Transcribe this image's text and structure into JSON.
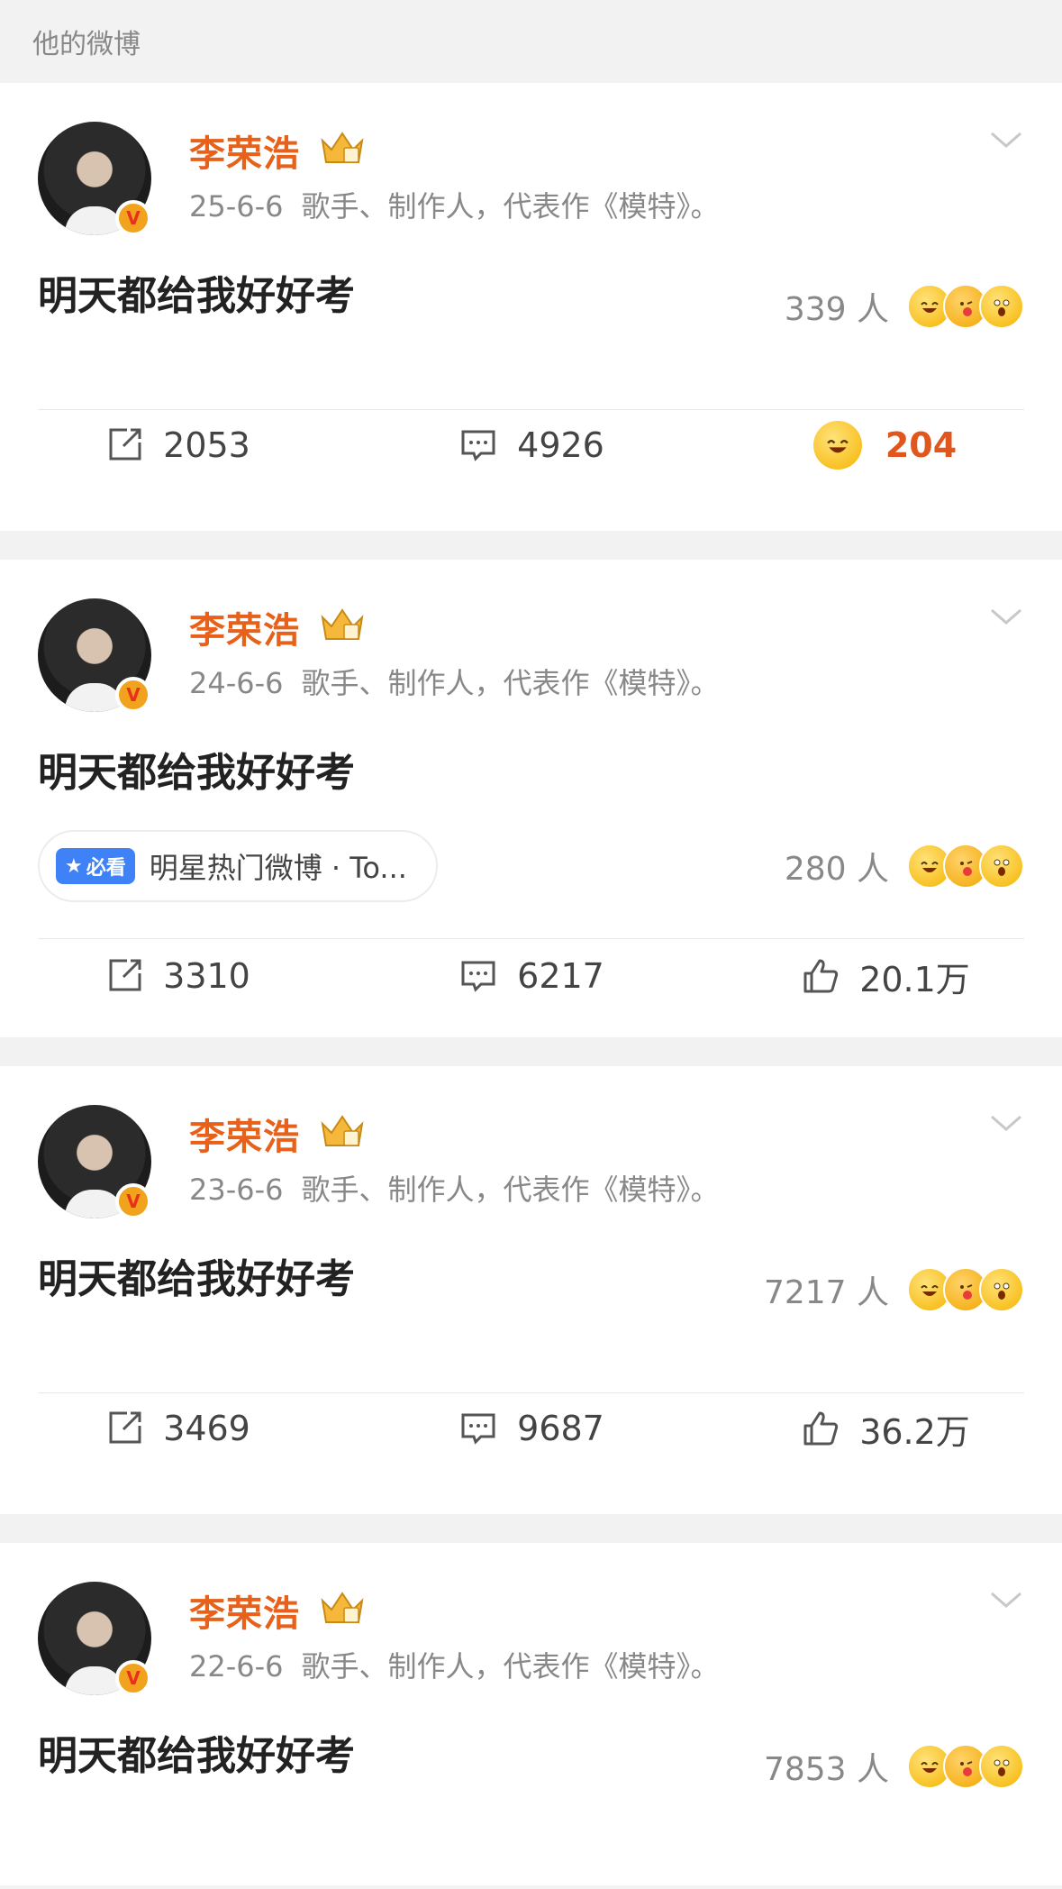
{
  "section_title": "他的微博",
  "posts": [
    {
      "author": "李荣浩",
      "date": "25-6-6",
      "bio": "歌手、制作人，代表作《模特》。",
      "text": "明天都给我好好考",
      "reaction_count": "339 人",
      "reposts": "2053",
      "comments": "4926",
      "likes": "204",
      "like_style": "emoji"
    },
    {
      "author": "李荣浩",
      "date": "24-6-6",
      "bio": "歌手、制作人，代表作《模特》。",
      "text": "明天都给我好好考",
      "tag_badge": "必看",
      "tag_text": "明星热门微博 · To...",
      "reaction_count": "280 人",
      "reposts": "3310",
      "comments": "6217",
      "likes": "20.1万",
      "like_style": "thumb"
    },
    {
      "author": "李荣浩",
      "date": "23-6-6",
      "bio": "歌手、制作人，代表作《模特》。",
      "text": "明天都给我好好考",
      "reaction_count": "7217 人",
      "reposts": "3469",
      "comments": "9687",
      "likes": "36.2万",
      "like_style": "thumb"
    },
    {
      "author": "李荣浩",
      "date": "22-6-6",
      "bio": "歌手、制作人，代表作《模特》。",
      "text": "明天都给我好好考",
      "reaction_count": "7853 人"
    }
  ],
  "icons": {
    "repost": "repost-icon",
    "comment": "comment-icon",
    "like": "thumbs-up-icon",
    "verified": "verified-v-icon",
    "crown": "crown-badge-icon",
    "more": "chevron-down-icon"
  },
  "colors": {
    "author_name": "#e8611b",
    "likes_highlight": "#e0561c",
    "tag_badge": "#3f82f7",
    "verified_badge": "#f2a31d"
  }
}
